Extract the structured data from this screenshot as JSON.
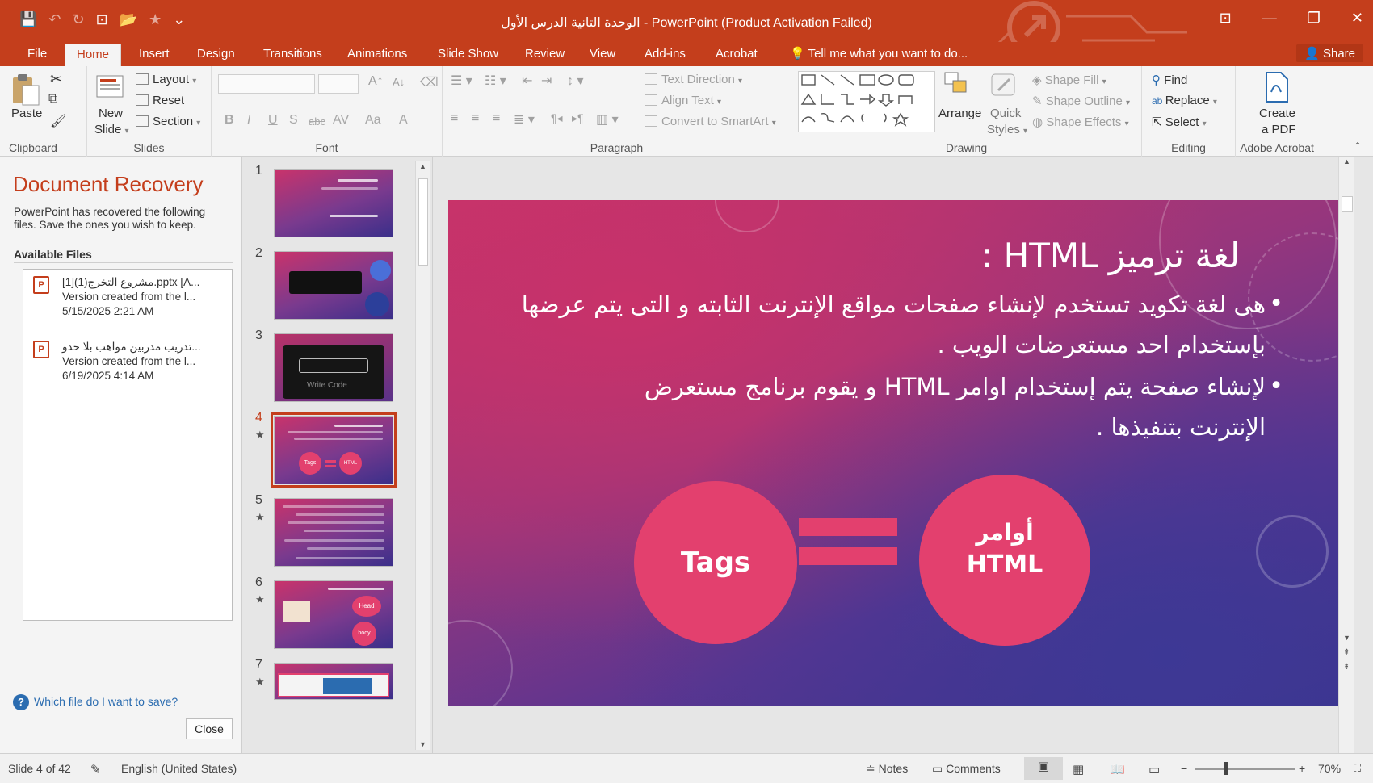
{
  "window": {
    "title": "الوحدة التانية الدرس الأول - PowerPoint (Product Activation Failed)",
    "share_label": "Share"
  },
  "tabs": [
    "File",
    "Home",
    "Insert",
    "Design",
    "Transitions",
    "Animations",
    "Slide Show",
    "Review",
    "View",
    "Add-ins",
    "Acrobat"
  ],
  "active_tab": "Home",
  "tell_me": "Tell me what you want to do...",
  "ribbon": {
    "clipboard": {
      "paste": "Paste",
      "label": "Clipboard"
    },
    "slides": {
      "new_slide_1": "New",
      "new_slide_2": "Slide",
      "layout": "Layout",
      "reset": "Reset",
      "section": "Section",
      "label": "Slides"
    },
    "font": {
      "label": "Font",
      "bold": "B",
      "italic": "I",
      "underline": "U",
      "shadow": "S",
      "strike": "abc",
      "spacing": "AV",
      "case": "Aa",
      "color": "A"
    },
    "paragraph": {
      "text_direction": "Text Direction",
      "align_text": "Align Text",
      "smartart": "Convert to SmartArt",
      "label": "Paragraph"
    },
    "drawing": {
      "arrange": "Arrange",
      "quick_styles_1": "Quick",
      "quick_styles_2": "Styles",
      "shape_fill": "Shape Fill",
      "shape_outline": "Shape Outline",
      "shape_effects": "Shape Effects",
      "label": "Drawing"
    },
    "editing": {
      "find": "Find",
      "replace": "Replace",
      "select": "Select",
      "label": "Editing"
    },
    "acrobat": {
      "create_1": "Create",
      "create_2": "a PDF",
      "label": "Adobe Acrobat"
    }
  },
  "recovery": {
    "title": "Document Recovery",
    "description": "PowerPoint has recovered the following files.  Save the ones you wish to keep.",
    "available_label": "Available Files",
    "files": [
      {
        "name": "مشروع التخرج(1)[1].pptx  [A...",
        "version": "Version created from the l...",
        "date": "5/15/2025 2:21 AM"
      },
      {
        "name": "تدريب مدربين مواهب بلا حدو...",
        "version": "Version created from the l...",
        "date": "6/19/2025 4:14 AM"
      }
    ],
    "help_link": "Which file do I want to save?",
    "close_label": "Close"
  },
  "thumbnails": [
    {
      "num": "1",
      "star": ""
    },
    {
      "num": "2",
      "star": ""
    },
    {
      "num": "3",
      "star": ""
    },
    {
      "num": "4",
      "star": "★"
    },
    {
      "num": "5",
      "star": "★"
    },
    {
      "num": "6",
      "star": "★"
    },
    {
      "num": "7",
      "star": "★"
    }
  ],
  "thumb_texts": {
    "write_code": "Write Code",
    "head": "Head",
    "body": "body",
    "tags": "Tags",
    "html": "HTML"
  },
  "slide": {
    "title": "لغة ترميز HTML :",
    "bullet1": "هى لغة تكويد تستخدم لإنشاء صفحات مواقع الإنترنت الثابته و التى يتم عرضها بإستخدام احد مستعرضات الويب .",
    "bullet2": "لإنشاء صفحة يتم إستخدام اوامر HTML و يقوم برنامج مستعرض الإنترنت بتنفيذها .",
    "bullet_symbol": "•",
    "left_circle": "Tags",
    "right_circle_1": "أوامر",
    "right_circle_2": "HTML"
  },
  "status": {
    "slide_of": "Slide 4 of 42",
    "language": "English (United States)",
    "notes": "Notes",
    "comments": "Comments",
    "zoom": "70%"
  },
  "colors": {
    "accent": "#c43e1c",
    "circle": "#e3406e"
  }
}
